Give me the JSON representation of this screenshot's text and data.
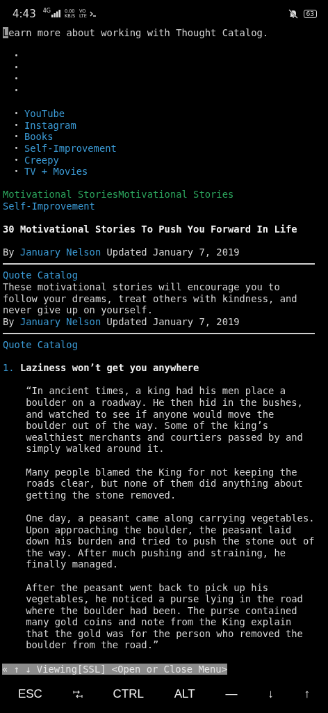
{
  "status_bar": {
    "time": "4:43",
    "network": "4G",
    "speed": "0.00",
    "speed_unit": "KB/S",
    "volte_top": "VO",
    "volte_bottom": "LTE",
    "battery": "63"
  },
  "lines": [
    {
      "kind": "text",
      "text": "Learn more about working with Thought Catalog.",
      "cursor": true
    },
    {
      "kind": "blank"
    },
    {
      "kind": "bullet",
      "bullet": "•"
    },
    {
      "kind": "bullet",
      "bullet": "•"
    },
    {
      "kind": "bullet",
      "bullet": "•"
    },
    {
      "kind": "bullet",
      "bullet": "•"
    },
    {
      "kind": "blank"
    },
    {
      "kind": "bullet",
      "bullet": "•",
      "label": "YouTube"
    },
    {
      "kind": "bullet",
      "bullet": "•",
      "label": "Instagram"
    },
    {
      "kind": "bullet",
      "bullet": "•",
      "label": "Books"
    },
    {
      "kind": "bullet",
      "bullet": "•",
      "label": "Self-Improvement"
    },
    {
      "kind": "bullet",
      "bullet": "•",
      "label": "Creepy"
    },
    {
      "kind": "bullet",
      "bullet": "•",
      "label": "TV + Movies"
    },
    {
      "kind": "blank"
    },
    {
      "kind": "category",
      "text": "Motivational StoriesMotivational Stories"
    },
    {
      "kind": "link",
      "text": "Self-Improvement"
    },
    {
      "kind": "blank"
    },
    {
      "kind": "heading",
      "text": "30 Motivational Stories To Push You Forward In Life"
    },
    {
      "kind": "blank"
    },
    {
      "kind": "byline",
      "by": "By",
      "author": "January Nelson",
      "updated": "Updated January 7, 2019"
    },
    {
      "kind": "rule"
    },
    {
      "kind": "link",
      "text": "Quote Catalog"
    },
    {
      "kind": "description",
      "text": "These motivational stories will encourage you to follow your dreams, treat others with kindness, and never give up on yourself."
    },
    {
      "kind": "byline",
      "by": "By",
      "author": "January Nelson",
      "updated": "Updated January 7, 2019"
    },
    {
      "kind": "rule"
    },
    {
      "kind": "link",
      "text": "Quote Catalog"
    },
    {
      "kind": "blank"
    },
    {
      "kind": "numbered",
      "number": "1.",
      "text": "Laziness won’t get you anywhere"
    },
    {
      "kind": "blank"
    },
    {
      "kind": "paragraph",
      "text": "“In ancient times, a king had his men place a boulder on a roadway. He then hid in the bushes, and watched to see if anyone would move the boulder out of the way. Some of the king’s wealthiest merchants and courtiers passed by and simply walked around it."
    },
    {
      "kind": "blank"
    },
    {
      "kind": "paragraph",
      "text": "Many people blamed the King for not keeping the roads clear, but none of them did anything about getting the stone removed."
    },
    {
      "kind": "blank"
    },
    {
      "kind": "paragraph",
      "text": "One day, a peasant came along carrying vegetables. Upon approaching the boulder, the peasant laid down his burden and tried to push the stone out of the way. After much pushing and straining, he finally managed."
    },
    {
      "kind": "blank"
    },
    {
      "kind": "paragraph",
      "text": "After the peasant went back to pick up his vegetables, he noticed a purse lying in the road where the boulder had been. The purse contained many gold coins and note from the King explain that the gold was for the person who removed the boulder from the road.”"
    }
  ],
  "lynx_status": "« ↑ ↓ Viewing[SSL] <Open or Close Menu>",
  "extra_keys": [
    {
      "kind": "text",
      "label": "ESC"
    },
    {
      "kind": "tab"
    },
    {
      "kind": "text",
      "label": "CTRL"
    },
    {
      "kind": "text",
      "label": "ALT"
    },
    {
      "kind": "text",
      "label": "—"
    },
    {
      "kind": "text",
      "label": "↓"
    },
    {
      "kind": "text",
      "label": "↑"
    }
  ]
}
